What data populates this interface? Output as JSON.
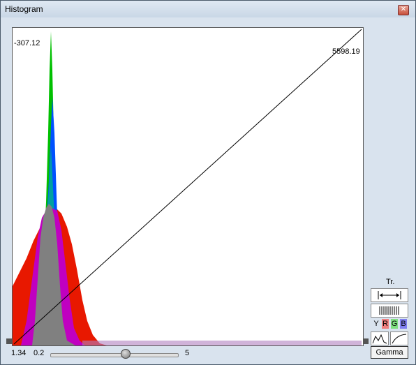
{
  "window": {
    "title": "Histogram",
    "close_symbol": "✕"
  },
  "plot": {
    "left_value": "-307.12",
    "right_value": "5598.19"
  },
  "bottom": {
    "gamma_value": "1.34",
    "slider_min": "0.2",
    "slider_max": "5"
  },
  "side": {
    "tr_label": "Tr.",
    "y_label": "Y",
    "r_label": "R",
    "g_label": "G",
    "b_label": "B",
    "gamma_button": "Gamma"
  },
  "colors": {
    "red": "#e81800",
    "green": "#00c000",
    "blue": "#0050ff",
    "magenta": "#c000c0",
    "gray": "#808080",
    "teal": "#00a0a0"
  }
}
